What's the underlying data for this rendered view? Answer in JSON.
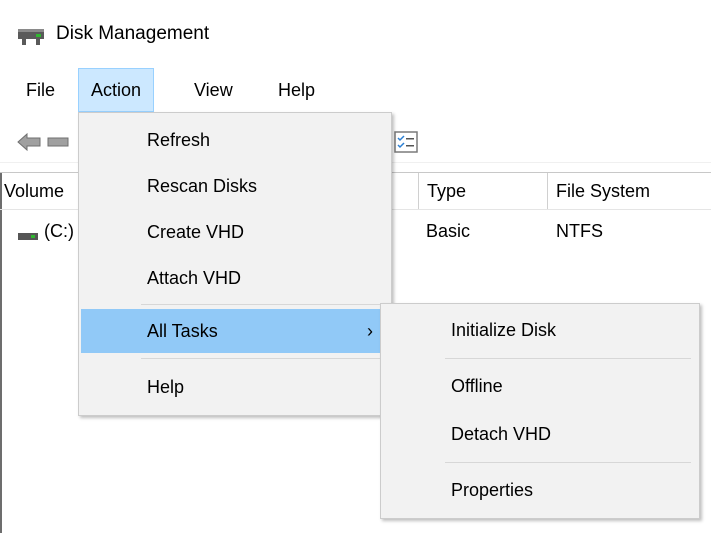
{
  "window": {
    "title": "Disk Management"
  },
  "menubar": {
    "items": [
      "File",
      "Action",
      "View",
      "Help"
    ]
  },
  "list": {
    "columns": [
      "Volume",
      "Type",
      "File System"
    ],
    "rows": [
      {
        "volume": "(C:)",
        "type": "Basic",
        "fs": "NTFS"
      }
    ]
  },
  "action_menu": {
    "items": [
      {
        "label": "Refresh"
      },
      {
        "label": "Rescan Disks"
      },
      {
        "label": "Create VHD"
      },
      {
        "label": "Attach VHD"
      },
      {
        "label": "All Tasks",
        "submenu_arrow": "›"
      },
      {
        "label": "Help"
      }
    ]
  },
  "all_tasks_submenu": {
    "items": [
      {
        "label": "Initialize Disk"
      },
      {
        "label": "Offline"
      },
      {
        "label": "Detach VHD"
      },
      {
        "label": "Properties"
      }
    ]
  },
  "colors": {
    "menu_bg": "#f2f2f2",
    "highlight": "#91c9f7",
    "active_menu": "#cce8ff"
  },
  "icons": {
    "app": "disk-drive-icon",
    "back": "back-arrow-icon",
    "forward": "forward-arrow-icon",
    "checklist": "checklist-icon",
    "drive": "drive-icon"
  }
}
